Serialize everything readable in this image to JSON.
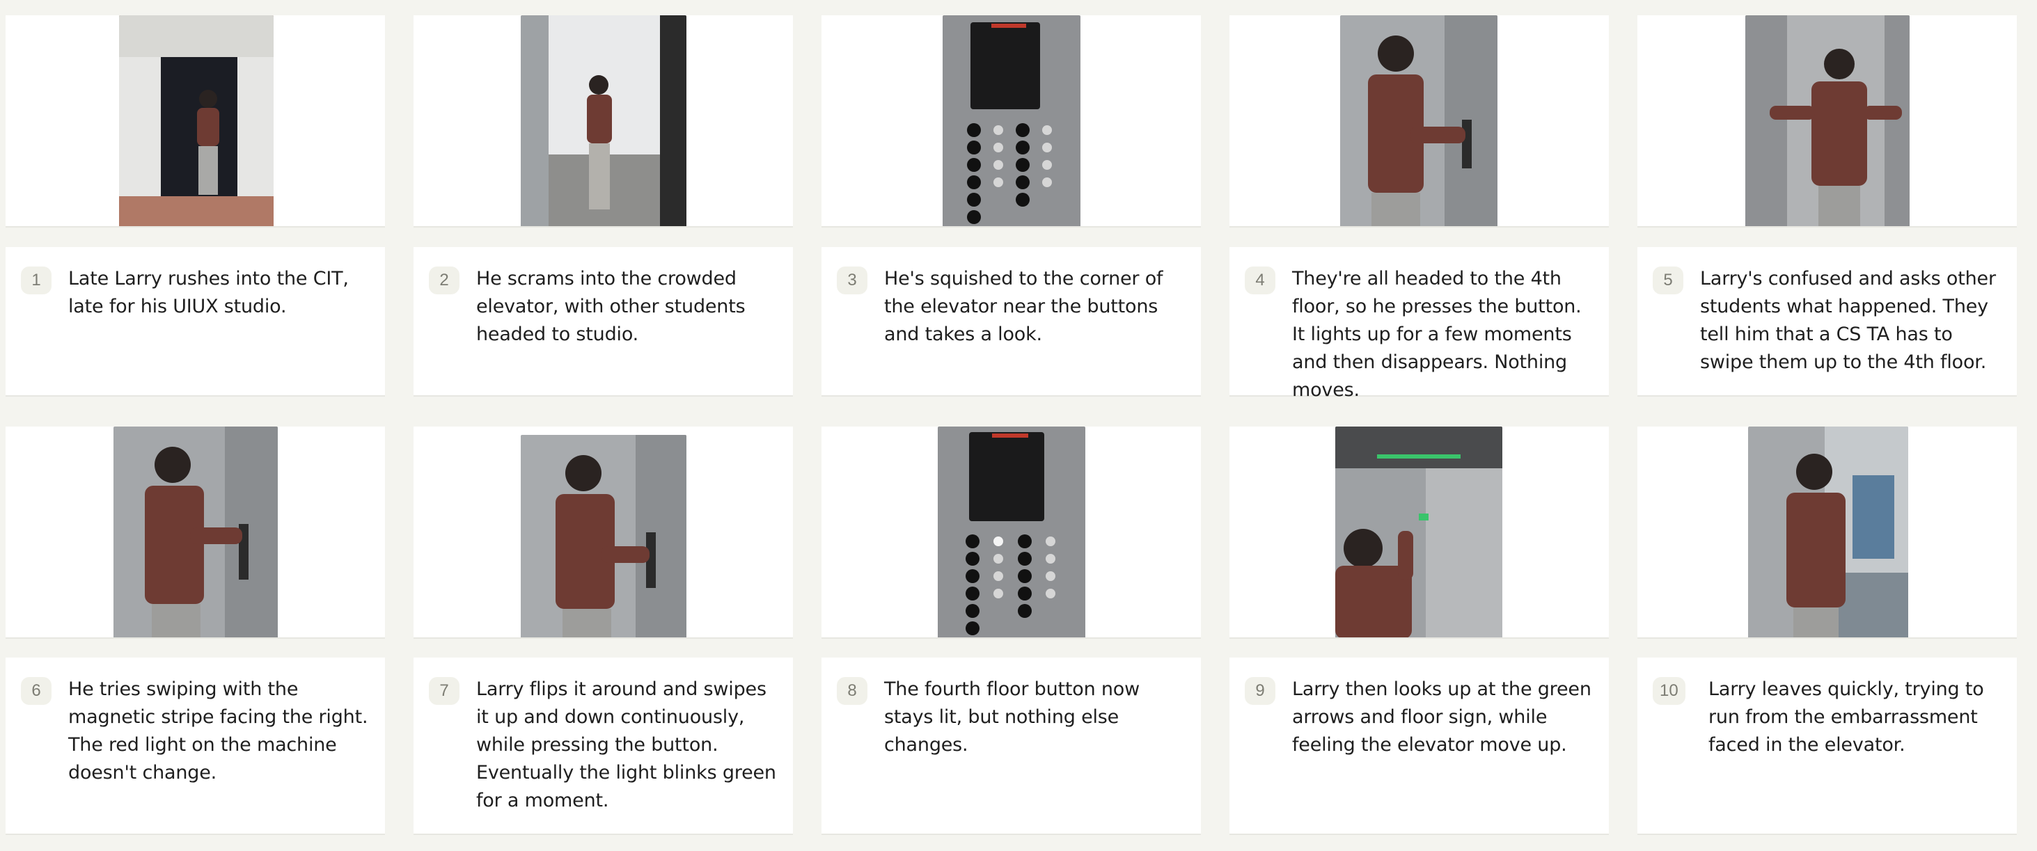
{
  "panels": [
    {
      "num": "1",
      "photo": "person-entering-doorway",
      "caption": "Late Larry rushes into the CIT, late for his UIUX studio."
    },
    {
      "num": "2",
      "photo": "person-walking-into-elevator",
      "caption": "He scrams into the crowded elevator, with other students headed to studio."
    },
    {
      "num": "3",
      "photo": "elevator-button-panel",
      "caption": "He's squished to the corner of the elevator near the buttons and takes a look."
    },
    {
      "num": "4",
      "photo": "person-pressing-button",
      "caption": "They're all headed to the 4th floor, so he presses the button. It lights up for a few moments and then disappears. Nothing moves."
    },
    {
      "num": "5",
      "photo": "person-confused-shrug",
      "caption": "Larry's confused and asks other students what happened. They tell him that a CS TA has to swipe them up to the 4th floor."
    },
    {
      "num": "6",
      "photo": "person-swiping-card",
      "caption": "He tries swiping with the magnetic stripe facing the right. The red light on the machine doesn't change."
    },
    {
      "num": "7",
      "photo": "person-swiping-card-again",
      "caption": "Larry flips it around and swipes it up and down continuously, while pressing the button. Eventually the light blinks green for a moment."
    },
    {
      "num": "8",
      "photo": "elevator-button-panel-lit",
      "caption": "The fourth floor button now stays lit, but nothing else changes."
    },
    {
      "num": "9",
      "photo": "person-looking-up-green-arrows",
      "caption": "Larry then looks up at the green arrows and floor sign, while feeling the elevator move up."
    },
    {
      "num": "10",
      "photo": "person-leaving-elevator",
      "caption": "Larry leaves quickly, trying to run from the embarrassment faced in the elevator."
    }
  ],
  "colors": {
    "background": "#f4f4ef",
    "card": "#ffffff",
    "badge": "#f1f1ea",
    "badge_text": "#7d7d74",
    "text": "#1f1f1f",
    "steel": "#a9abad",
    "sweater": "#6e3b33"
  }
}
